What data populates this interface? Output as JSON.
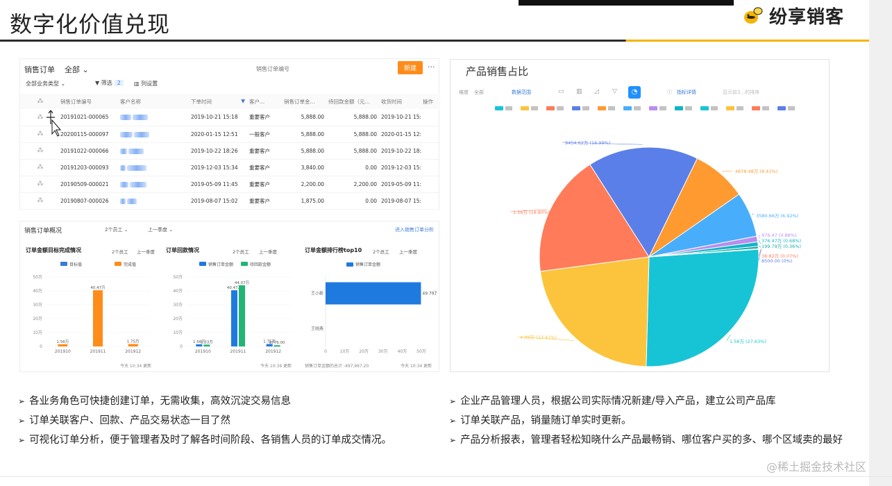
{
  "header": {
    "title": "数字化价值兑现",
    "brand": "纷享销客"
  },
  "orders": {
    "title": "销售订单",
    "scope": "全部",
    "search_placeholder": "销售订单编号",
    "new_button": "新建",
    "more": "···",
    "biz_type": "全部业务类型",
    "filter_label": "筛选",
    "filter_count": "2",
    "columns_label": "列设置",
    "headers": [
      "销售订单编号",
      "客户名称",
      "下单时间",
      "客户...",
      "销售订单金...",
      "待回款金额（元...",
      "收货时间",
      "操作"
    ],
    "rows": [
      {
        "id": "20191021-000065",
        "time": "2019-10-21 15:18",
        "level": "重要客户",
        "amount": "5,888.00",
        "due": "5,888.00",
        "recv": "2019-10-21 15:"
      },
      {
        "id": "20200115-000097",
        "time": "2020-01-15 12:51",
        "level": "一般客户",
        "amount": "5,888.00",
        "due": "5,888.00",
        "recv": "2020-01-15 12:"
      },
      {
        "id": "20191022-000066",
        "time": "2019-10-22 18:26",
        "level": "重要客户",
        "amount": "5,888.00",
        "due": "5,888.00",
        "recv": "2019-10-22 18:"
      },
      {
        "id": "20191203-000093",
        "time": "2019-12-03 15:34",
        "level": "重要客户",
        "amount": "3,840.00",
        "due": "0.00",
        "recv": "2019-12-03 15:"
      },
      {
        "id": "20190509-000021",
        "time": "2019-05-09 11:45",
        "level": "重要客户",
        "amount": "2,200.00",
        "due": "2,200.00",
        "recv": "2019-05-09 11:"
      },
      {
        "id": "20190807-000026",
        "time": "2019-08-07 15:02",
        "level": "重要客户",
        "amount": "1,875.00",
        "due": "0.00",
        "recv": "2019-08-07 15:"
      }
    ]
  },
  "overview": {
    "title": "销售订单概况",
    "emp": "2个员工",
    "period": "上一季度",
    "link": "进入销售订单分析",
    "footer_time": "今天 10:34 更新"
  },
  "chart_data": [
    {
      "type": "bar",
      "title": "订单金额目标完成情况",
      "controls": [
        "2个员工",
        "上一季度"
      ],
      "legend": [
        "目标值",
        "完成值"
      ],
      "categories": [
        "201910",
        "201911",
        "201912"
      ],
      "series": [
        {
          "name": "目标值",
          "values": [
            0,
            0,
            0
          ]
        },
        {
          "name": "完成值",
          "values": [
            1.56,
            40.47,
            1.75
          ]
        }
      ],
      "data_labels": [
        "1.56万",
        "40.47万",
        "1.75万"
      ],
      "yticks": [
        "0",
        "10万",
        "20万",
        "30万",
        "40万",
        "50万"
      ],
      "ylim": [
        0,
        50
      ],
      "footer": "今天 10:34 更新",
      "colors": [
        "#3a7bd5",
        "#ff8c1a"
      ]
    },
    {
      "type": "bar",
      "title": "订单回款情况",
      "controls": [
        "2个员工",
        "上一季度"
      ],
      "legend": [
        "销售订单金额",
        "待回款金额"
      ],
      "categories": [
        "201910",
        "201911",
        "201912"
      ],
      "series": [
        {
          "name": "销售订单金额",
          "values": [
            1.56,
            40.47,
            1.75
          ]
        },
        {
          "name": "待回款金额",
          "values": [
            1.33,
            44.07,
            0.88
          ]
        }
      ],
      "data_labels": [
        [
          "1.56万",
          "40.47万",
          "1.75万"
        ],
        [
          "1.33万",
          "44.07万",
          "8776.00"
        ]
      ],
      "yticks": [
        "0",
        "10万",
        "20万",
        "30万",
        "40万",
        "50万"
      ],
      "ylim": [
        0,
        50
      ],
      "footer": "今天 10:34 更新",
      "colors": [
        "#1f7ae0",
        "#22b573"
      ]
    },
    {
      "type": "bar",
      "orientation": "horizontal",
      "title": "订单金额排行榜top10",
      "controls": [
        "2个员工",
        "上一季度"
      ],
      "legend": [
        "销售订单金额"
      ],
      "categories": [
        "王小新",
        "王晓燕"
      ],
      "values": [
        49.79,
        0
      ],
      "data_labels": [
        "49.79万"
      ],
      "xticks": [
        "0",
        "10万",
        "20万",
        "30万",
        "40万",
        "50万"
      ],
      "xlim": [
        0,
        50
      ],
      "footer": "销售订单金额的总计 :497,967.20",
      "footer2": "今天 10:34 更新",
      "colors": [
        "#1f7ae0"
      ]
    },
    {
      "type": "pie",
      "title": "产品销售占比",
      "toolbar": [
        "维度",
        "全部",
        "数据范围",
        "指标详情",
        "显示前3...的排序"
      ],
      "slices": [
        {
          "label": "1.56万 (27.63%)",
          "value": 27.63,
          "color": "#17c4d6"
        },
        {
          "label": "4.88万 (23.41%)",
          "value": 23.41,
          "color": "#fbc43c"
        },
        {
          "label": "1.56万 (18.80%)",
          "value": 18.8,
          "color": "#ff7b59"
        },
        {
          "label": "9454.62万 (16.99%)",
          "value": 16.99,
          "color": "#5b7fe8"
        },
        {
          "label": "4678.48万 (8.41%)",
          "value": 8.41,
          "color": "#ff9a30"
        },
        {
          "label": "3580.66万 (6.92%)",
          "value": 6.92,
          "color": "#48aefc"
        },
        {
          "label": "976.47 (0.88%)",
          "value": 0.88,
          "color": "#b98cf2"
        },
        {
          "label": "376.47万 (0.68%)",
          "value": 0.68,
          "color": "#10b5c8"
        },
        {
          "label": "199.79万 (0.36%)",
          "value": 0.36,
          "color": "#18a9a5"
        },
        {
          "label": "38.82万 (0.07%)",
          "value": 0.07,
          "color": "#ff7b59"
        },
        {
          "label": "8500.00 (0%)",
          "value": 0.01,
          "color": "#5b7fe8"
        }
      ],
      "legend_colors": [
        "#17c4d6",
        "#fbc43c",
        "#ff7b59",
        "#5b7fe8",
        "#ff9a30",
        "#48aefc",
        "#b98cf2",
        "#10b5c8",
        "#17c4d6",
        "#fbc43c",
        "#ff7b59",
        "#5b7fe8"
      ]
    }
  ],
  "bullets_left": [
    "各业务角色可快捷创建订单，无需收集，高效沉淀交易信息",
    "订单关联客户、回款、产品交易状态一目了然",
    "可视化订单分析，便于管理者及时了解各时间阶段、各销售人员的订单成交情况。"
  ],
  "bullets_right": [
    "企业产品管理人员，根据公司实际情况新建/导入产品，建立公司产品库",
    "订单关联产品，销量随订单实时更新。",
    "产品分析报表，管理者轻松知晓什么产品最畅销、哪位客户买的多、哪个区域卖的最好"
  ],
  "watermark": "@稀土掘金技术社区"
}
